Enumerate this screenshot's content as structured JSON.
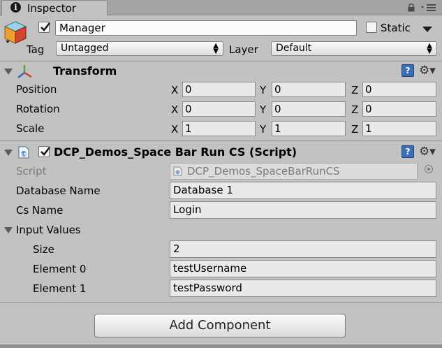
{
  "tab": {
    "label": "Inspector",
    "icon": "info-icon"
  },
  "window_icons": [
    "lock-icon",
    "menu-icon"
  ],
  "gameobject": {
    "name": "Manager",
    "active": true,
    "static_label": "Static",
    "static_checked": false,
    "tag_label": "Tag",
    "tag_value": "Untagged",
    "layer_label": "Layer",
    "layer_value": "Default"
  },
  "transform": {
    "title": "Transform",
    "rows": [
      {
        "label": "Position",
        "x": "0",
        "y": "0",
        "z": "0"
      },
      {
        "label": "Rotation",
        "x": "0",
        "y": "0",
        "z": "0"
      },
      {
        "label": "Scale",
        "x": "1",
        "y": "1",
        "z": "1"
      }
    ],
    "axis_labels": {
      "x": "X",
      "y": "Y",
      "z": "Z"
    }
  },
  "script_component": {
    "title": "DCP_Demos_Space Bar Run CS (Script)",
    "enabled": true,
    "script_label": "Script",
    "script_value": "DCP_Demos_SpaceBarRunCS",
    "fields": [
      {
        "label": "Database Name",
        "value": "Database 1"
      },
      {
        "label": "Cs Name",
        "value": "Login"
      }
    ],
    "input_values": {
      "label": "Input Values",
      "size_label": "Size",
      "size_value": "2",
      "elements": [
        {
          "label": "Element 0",
          "value": "testUsername"
        },
        {
          "label": "Element 1",
          "value": "testPassword"
        }
      ]
    }
  },
  "add_component_label": "Add Component",
  "colors": {
    "panel_bg": "#c2c2c2",
    "help_icon": "#3c6fb6",
    "disabled_text": "#7b7b7b"
  }
}
